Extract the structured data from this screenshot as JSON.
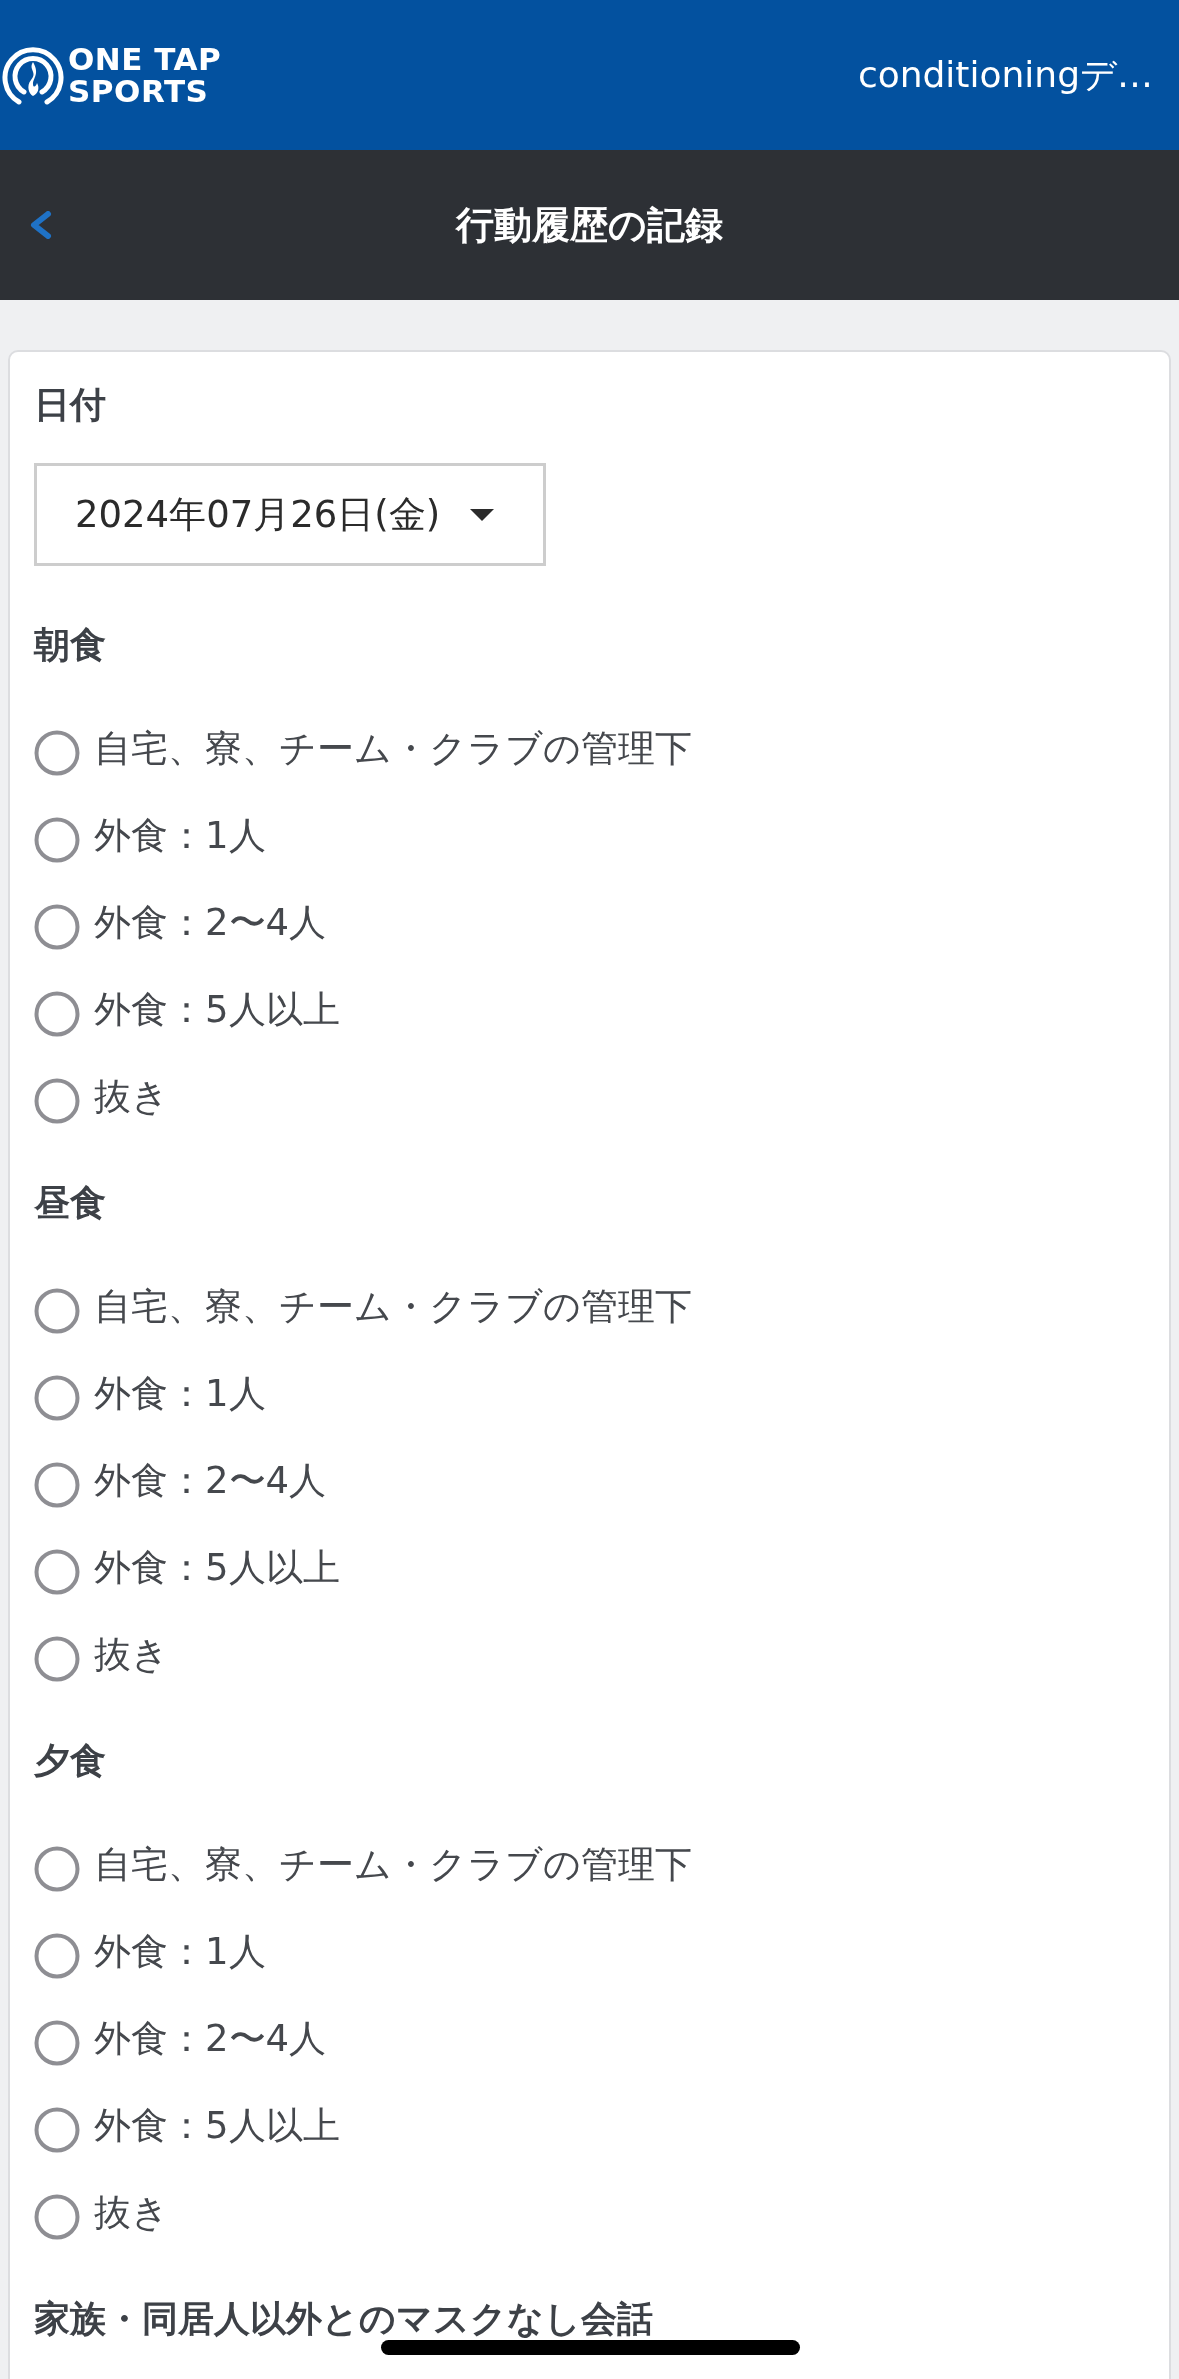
{
  "header": {
    "logo": {
      "lines": [
        "ONE TAP",
        "SPORTS"
      ]
    },
    "title": "conditioningデ…"
  },
  "nav": {
    "title": "行動履歴の記録"
  },
  "form": {
    "date": {
      "label": "日付",
      "value": "2024年07月26日(金)"
    },
    "sections": [
      {
        "label": "朝食",
        "options": [
          {
            "label": "自宅、寮、チーム・クラブの管理下",
            "selected": false
          },
          {
            "label": "外食：1人",
            "selected": false
          },
          {
            "label": "外食：2〜4人",
            "selected": false
          },
          {
            "label": "外食：5人以上",
            "selected": false
          },
          {
            "label": "抜き",
            "selected": false
          }
        ]
      },
      {
        "label": "昼食",
        "options": [
          {
            "label": "自宅、寮、チーム・クラブの管理下",
            "selected": false
          },
          {
            "label": "外食：1人",
            "selected": false
          },
          {
            "label": "外食：2〜4人",
            "selected": false
          },
          {
            "label": "外食：5人以上",
            "selected": false
          },
          {
            "label": "抜き",
            "selected": false
          }
        ]
      },
      {
        "label": "夕食",
        "options": [
          {
            "label": "自宅、寮、チーム・クラブの管理下",
            "selected": false
          },
          {
            "label": "外食：1人",
            "selected": false
          },
          {
            "label": "外食：2〜4人",
            "selected": false
          },
          {
            "label": "外食：5人以上",
            "selected": false
          },
          {
            "label": "抜き",
            "selected": false
          }
        ]
      },
      {
        "label": "家族・同居人以外とのマスクなし会話"
      }
    ]
  }
}
